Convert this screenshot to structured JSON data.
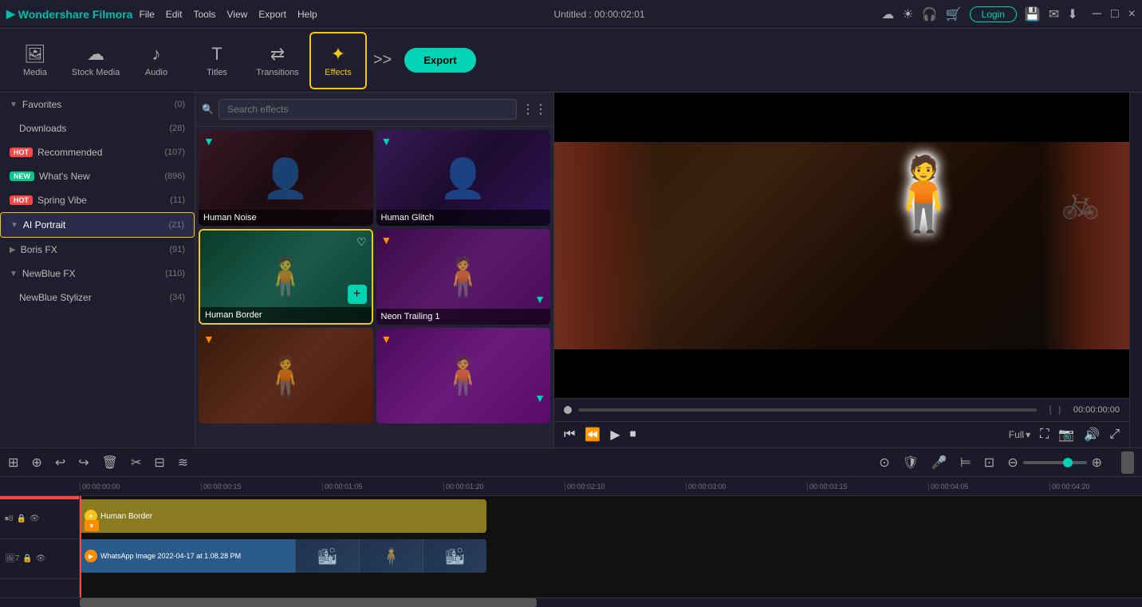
{
  "app": {
    "name": "Wondershare Filmora",
    "title": "Untitled : 00:00:02:01"
  },
  "menu": {
    "items": [
      "File",
      "Edit",
      "Tools",
      "View",
      "Export",
      "Help"
    ]
  },
  "title_bar_icons": [
    "cloud",
    "sun",
    "headset",
    "cart",
    "login",
    "save",
    "mail",
    "download"
  ],
  "login_label": "Login",
  "window_controls": [
    "─",
    "□",
    "×"
  ],
  "toolbar": {
    "items": [
      {
        "id": "media",
        "icon": "□",
        "label": "Media"
      },
      {
        "id": "stock",
        "icon": "☁",
        "label": "Stock Media"
      },
      {
        "id": "audio",
        "icon": "♪",
        "label": "Audio"
      },
      {
        "id": "titles",
        "icon": "T",
        "label": "Titles"
      },
      {
        "id": "transitions",
        "icon": "⇄",
        "label": "Transitions"
      },
      {
        "id": "effects",
        "icon": "✦",
        "label": "Effects",
        "active": true
      }
    ],
    "export_label": "Export",
    "more_icon": ">>"
  },
  "sidebar": {
    "items": [
      {
        "id": "favorites",
        "label": "Favorites",
        "count": "(0)",
        "badge": null,
        "arrow": "▼"
      },
      {
        "id": "downloads",
        "label": "Downloads",
        "count": "(28)",
        "badge": null,
        "arrow": null,
        "indent": true
      },
      {
        "id": "recommended",
        "label": "Recommended",
        "count": "(107)",
        "badge": "HOT",
        "badge_type": "hot",
        "arrow": null
      },
      {
        "id": "whats-new",
        "label": "What's New",
        "count": "(896)",
        "badge": "NEW",
        "badge_type": "new",
        "arrow": null
      },
      {
        "id": "spring-vibe",
        "label": "Spring Vibe",
        "count": "(11)",
        "badge": "HOT",
        "badge_type": "hot",
        "arrow": null
      },
      {
        "id": "ai-portrait",
        "label": "AI Portrait",
        "count": "(21)",
        "badge": null,
        "arrow": "▶",
        "active": true
      },
      {
        "id": "boris-fx",
        "label": "Boris FX",
        "count": "(91)",
        "badge": null,
        "arrow": "▶"
      },
      {
        "id": "newblue-fx",
        "label": "NewBlue FX",
        "count": "(110)",
        "badge": null,
        "arrow": "▼"
      },
      {
        "id": "newblue-stylizer",
        "label": "NewBlue Stylizer",
        "count": "(34)",
        "badge": null,
        "arrow": null,
        "indent": true
      }
    ]
  },
  "effects": {
    "search_placeholder": "Search effects",
    "cards": [
      {
        "id": "human-noise",
        "label": "Human Noise",
        "bg": "effect-bg-1",
        "has_teal_arrow": true
      },
      {
        "id": "human-glitch",
        "label": "Human Glitch",
        "bg": "effect-bg-2",
        "has_teal_arrow": true
      },
      {
        "id": "human-border",
        "label": "Human Border",
        "bg": "effect-bg-3",
        "has_heart": true,
        "has_add": true,
        "highlighted": true
      },
      {
        "id": "neon-trailing-1",
        "label": "Neon Trailing 1",
        "bg": "effect-bg-4",
        "has_orange_arrow": true,
        "has_teal_down": true
      },
      {
        "id": "effect-5",
        "label": "",
        "bg": "effect-bg-1",
        "has_orange_arrow": true
      },
      {
        "id": "effect-6",
        "label": "",
        "bg": "effect-bg-4",
        "has_orange_arrow": true,
        "has_teal_down": true
      }
    ]
  },
  "preview": {
    "time": "00:00:00:00",
    "quality": "Full",
    "buttons": [
      "skip-back",
      "step-back",
      "play",
      "stop"
    ]
  },
  "timeline": {
    "toolbar_buttons": [
      "undo",
      "redo",
      "delete",
      "cut",
      "audio-mix",
      "waveform"
    ],
    "right_buttons": [
      "ripple",
      "magnet",
      "voice",
      "subtitle",
      "pip",
      "zoom-out",
      "zoom-in"
    ],
    "ruler_marks": [
      "00:00:00:00",
      "00:00:00:15",
      "00:00:01:05",
      "00:00:01:20",
      "00:00:02:10",
      "00:00:03:00",
      "00:00:03:15",
      "00:00:04:05",
      "00:00:04:20"
    ],
    "tracks": [
      {
        "id": "track-8",
        "label": "8",
        "type": "effect"
      },
      {
        "id": "track-7",
        "label": "7",
        "type": "video"
      }
    ],
    "effect_clip_label": "Human Border",
    "video_clip_label": "WhatsApp Image 2022-04-17 at 1.08.28 PM"
  }
}
